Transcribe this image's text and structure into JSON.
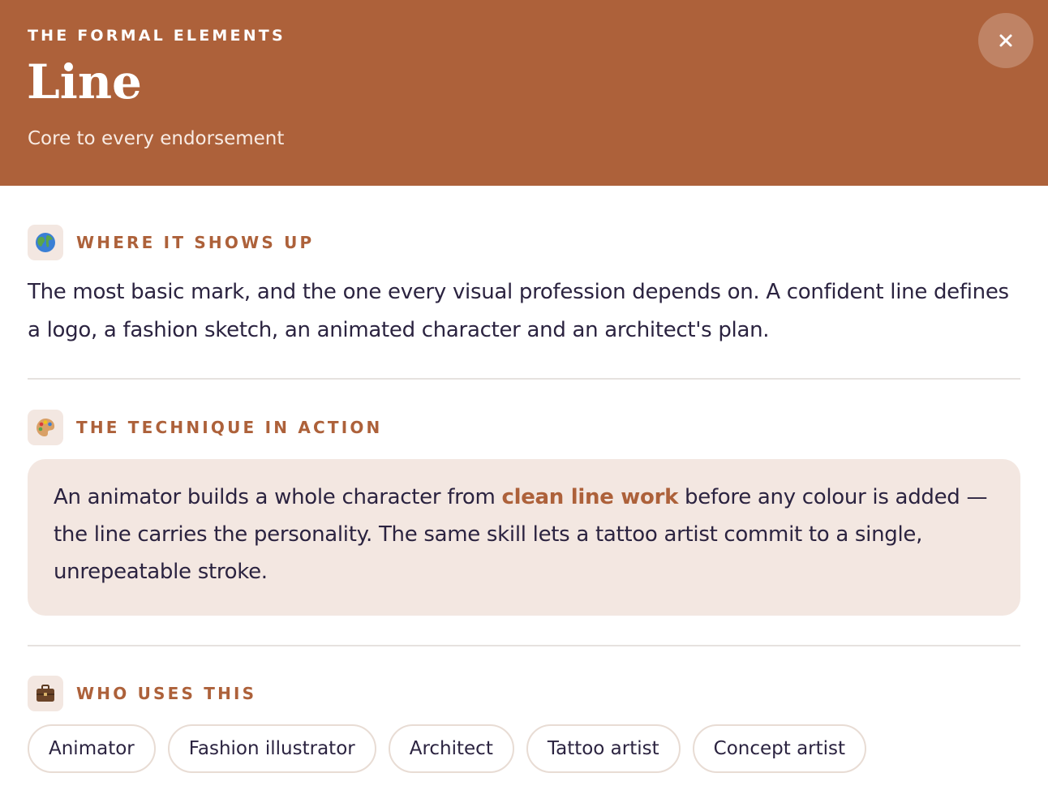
{
  "header": {
    "eyebrow": "THE FORMAL ELEMENTS",
    "title": "Line",
    "subtitle": "Core to every endorsement",
    "bg_color": "#ad613a"
  },
  "close_button": {
    "icon": "close-icon",
    "label": "×"
  },
  "sections": [
    {
      "icon": "globe-icon",
      "emoji": "🌎",
      "label": "WHERE IT SHOWS UP",
      "text": "The most basic mark, and the one every visual profession depends on. A confident line defines a logo, a fashion sketch, an animated character and an architect's plan."
    },
    {
      "icon": "palette-icon",
      "emoji": "🎨",
      "label": "THE TECHNIQUE IN ACTION",
      "text_before": "An animator builds a whole character from ",
      "highlight": "clean line work",
      "text_after": " before any colour is added — the line carries the personality. The same skill lets a tattoo artist commit to a single, unrepeatable stroke."
    },
    {
      "icon": "briefcase-icon",
      "emoji": "💼",
      "label": "WHO USES THIS",
      "chips": [
        "Animator",
        "Fashion illustrator",
        "Architect",
        "Tattoo artist",
        "Concept artist"
      ]
    }
  ],
  "colors": {
    "accent": "#ad613a",
    "tile_bg": "#f3e7e1",
    "text": "#2b2340"
  }
}
